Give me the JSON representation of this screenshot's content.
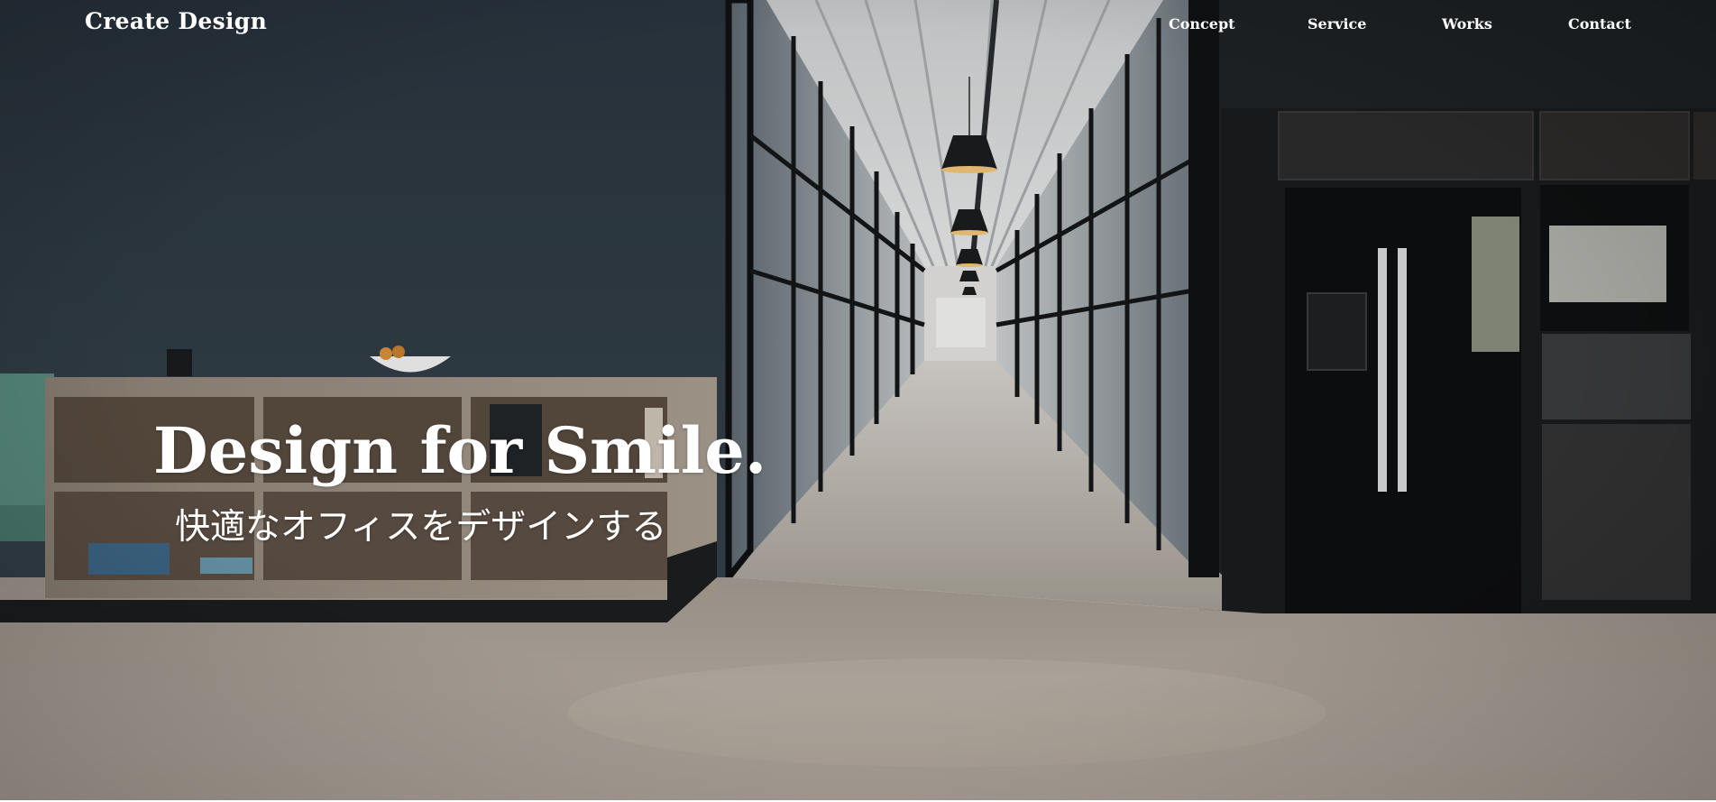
{
  "header": {
    "logo": "Create Design",
    "nav": [
      {
        "label": "Concept"
      },
      {
        "label": "Service"
      },
      {
        "label": "Works"
      },
      {
        "label": "Contact"
      }
    ]
  },
  "hero": {
    "title": "Design for Smile.",
    "subtitle": "快適なオフィスをデザインする",
    "background": "office-interior-photo"
  },
  "colors": {
    "text": "#ffffff",
    "wall": "#2f3a44",
    "floor": "#b1a89e"
  }
}
